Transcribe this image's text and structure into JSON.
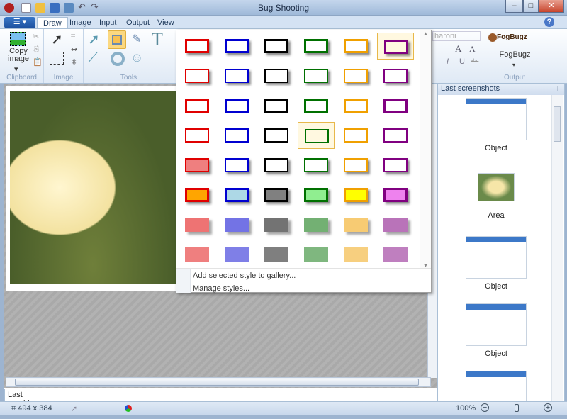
{
  "window": {
    "title": "Bug Shooting",
    "minimize": "–",
    "maximize": "□",
    "close": "✕"
  },
  "tabs": [
    "Draw",
    "Image",
    "Input",
    "Output",
    "View"
  ],
  "ribbon": {
    "clipboard": {
      "copy_label": "Copy image",
      "dropdown": "▾",
      "group": "Clipboard"
    },
    "image": {
      "group": "Image"
    },
    "tools": {
      "group": "Tools",
      "text_tool": "T"
    },
    "font": {
      "name": "haroni",
      "grow": "A",
      "shrink": "A",
      "italic": "I",
      "underline": "U",
      "strike": "abc"
    },
    "output": {
      "logo": "FogBugz",
      "button": "FogBugz",
      "dropdown": "▾",
      "group": "Output"
    },
    "help": "?"
  },
  "gallery": {
    "colors": [
      "#e00000",
      "#0000d0",
      "#000000",
      "#007000",
      "#f0a000",
      "#800080"
    ],
    "fills": [
      "#ffa500",
      "#add8e6",
      "#808080",
      "#90ee90",
      "#ffff00",
      "#ee82ee"
    ],
    "selected": [
      [
        0,
        5
      ],
      [
        3,
        3
      ]
    ],
    "menu": [
      "Add selected style to gallery...",
      "Manage styles..."
    ]
  },
  "panel": {
    "title": "Last screenshots",
    "pin": "⊥",
    "items": [
      "Object",
      "Area",
      "Object",
      "Object"
    ]
  },
  "bottom_tab": "Last graphics",
  "status": {
    "size": "494 x 384",
    "zoom": "100%",
    "zoom_level": 0.5
  }
}
